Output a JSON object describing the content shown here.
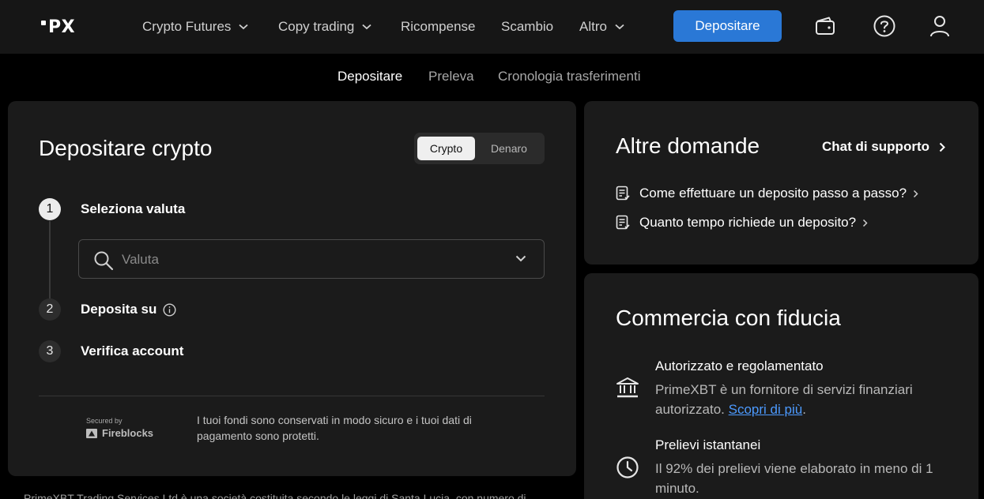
{
  "header": {
    "logo_text": "PX",
    "nav": [
      {
        "label": "Crypto Futures"
      },
      {
        "label": "Copy trading"
      },
      {
        "label": "Ricompense"
      },
      {
        "label": "Scambio"
      },
      {
        "label": "Altro"
      }
    ],
    "deposit_button": "Depositare",
    "icons": [
      "wallet-icon",
      "help-icon",
      "user-icon"
    ]
  },
  "subtabs": [
    {
      "label": "Depositare",
      "active": true
    },
    {
      "label": "Preleva",
      "active": false
    },
    {
      "label": "Cronologia trasferimenti",
      "active": false
    }
  ],
  "deposit": {
    "title": "Depositare crypto",
    "toggle": {
      "selected": "Crypto",
      "other": "Denaro"
    },
    "steps": [
      {
        "number": "1",
        "label": "Seleziona valuta"
      },
      {
        "number": "2",
        "label": "Deposita su"
      },
      {
        "number": "3",
        "label": "Verifica account"
      }
    ],
    "currency_select": {
      "placeholder": "Valuta"
    },
    "secured_by": "Secured by",
    "secured_brand": "Fireblocks",
    "secure_text": "I tuoi fondi sono conservati in modo sicuro e i tuoi dati di pagamento sono protetti."
  },
  "footer_text": "PrimeXBT Trading Services Ltd è una società costituita secondo le leggi di Santa Lucia, con numero di",
  "questions": {
    "title": "Altre domande",
    "support_link": "Chat di supporto",
    "items": [
      {
        "label": "Come effettuare un deposito passo a passo?"
      },
      {
        "label": "Quanto tempo richiede un deposito?"
      }
    ]
  },
  "trust": {
    "title": "Commercia con fiducia",
    "items": [
      {
        "title": "Autorizzato e regolamentato",
        "desc": "PrimeXBT è un fornitore di servizi finanziari autorizzato.",
        "link": "Scopri di più",
        "after_link": "."
      },
      {
        "title": "Prelievi istantanei",
        "desc": "Il 92% dei prelievi viene elaborato in meno di 1 minuto."
      }
    ]
  },
  "colors": {
    "accent": "#2a78d6",
    "link": "#4c9aff",
    "panel": "#1b1b1b",
    "topbar": "#161616"
  }
}
